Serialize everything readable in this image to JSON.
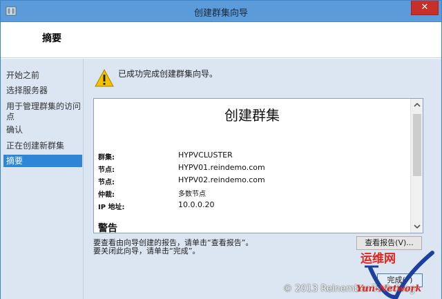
{
  "window": {
    "title": "创建群集向导",
    "close_glyph": "✕"
  },
  "header": {
    "title": "摘要"
  },
  "nav": {
    "items": [
      {
        "label": "开始之前",
        "selected": false
      },
      {
        "label": "选择服务器",
        "selected": false
      },
      {
        "label": "用于管理群集的访问点",
        "selected": false
      },
      {
        "label": "确认",
        "selected": false
      },
      {
        "label": "正在创建新群集",
        "selected": false
      },
      {
        "label": "摘要",
        "selected": true
      }
    ]
  },
  "content": {
    "status_message": "已成功完成创建群集向导。",
    "report": {
      "title": "创建群集",
      "rows": [
        {
          "label": "群集:",
          "value": "HYPVCLUSTER"
        },
        {
          "label": "节点:",
          "value": "HYPV01.reindemo.com"
        },
        {
          "label": "节点:",
          "value": "HYPV02.reindemo.com"
        },
        {
          "label": "仲裁:",
          "value": "多数节点"
        },
        {
          "label": "IP 地址:",
          "value": "10.0.0.20"
        }
      ],
      "warning_heading": "警告"
    },
    "hint_line1": "要查看由向导创建的报告，请单击“查看报告”。",
    "hint_line2": "要关闭此向导，请单击“完成”。",
    "view_report_label": "查看报告(V)...",
    "finish_label": "完成(F)"
  },
  "watermark": {
    "text": "© 2013 Reinember Tech Blog",
    "logo_text_cn": "运维网",
    "logo_text_en": "Yun-Network"
  },
  "colors": {
    "titlebar": "#5b9bd9",
    "close": "#c7302a",
    "body_bg": "#dce6f3",
    "selected": "#2f86d6",
    "logo_red": "#e0261b",
    "logo_blue": "#1d3f9e"
  }
}
